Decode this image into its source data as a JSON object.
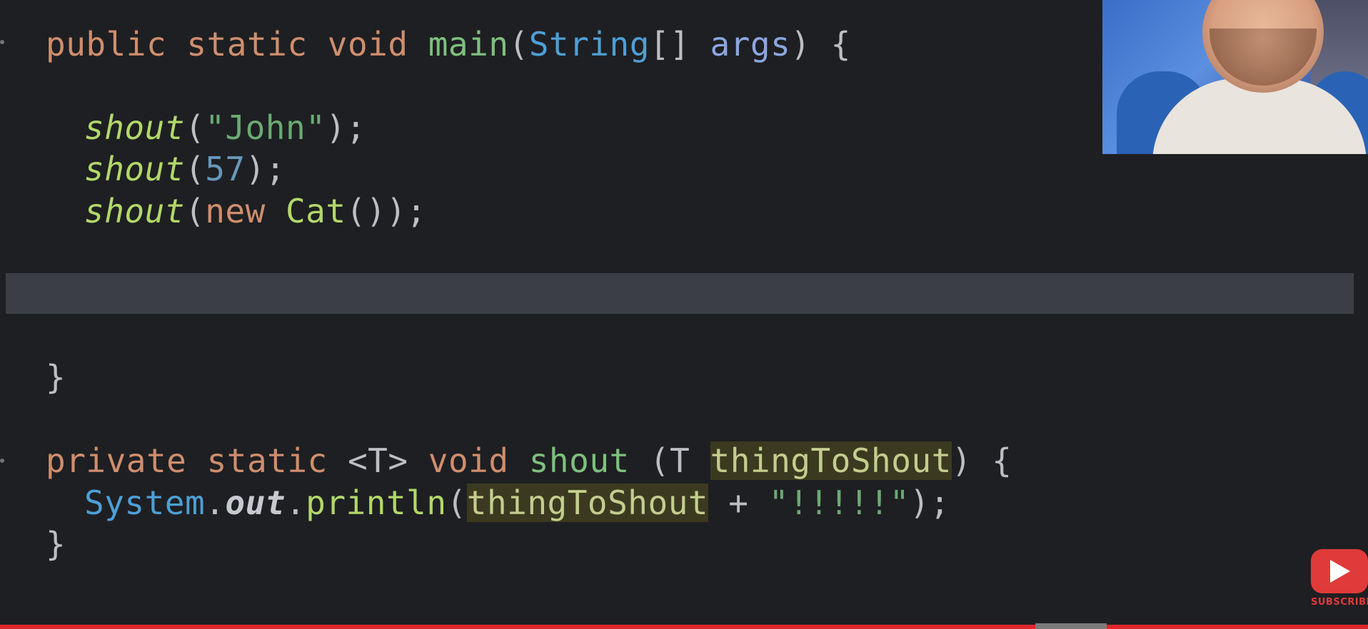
{
  "editor": {
    "lines": {
      "l1": {
        "kw1": "public",
        "kw2": "static",
        "kw3": "void",
        "fn": "main",
        "open": "(",
        "type": "String",
        "brackets": "[] ",
        "param": "args",
        "close": ") {"
      },
      "l2": {
        "call": "shout",
        "open": "(",
        "str": "\"John\"",
        "close": ");"
      },
      "l3": {
        "call": "shout",
        "open": "(",
        "num": "57",
        "close": ");"
      },
      "l4": {
        "call": "shout",
        "open": "(",
        "kw": "new",
        "cls": "Cat",
        "close": "());"
      },
      "l5": {
        "brace": "}"
      },
      "l6": {
        "kw1": "private",
        "kw2": "static",
        "tparam": "<T>",
        "kw3": "void",
        "fn": "shout",
        "open": " (T ",
        "param": "thingToShout",
        "close": ") {"
      },
      "l7": {
        "cls": "System",
        "dot1": ".",
        "field": "out",
        "dot2": ".",
        "method": "println",
        "open": "(",
        "param": "thingToShout",
        "plus": " + ",
        "str": "\"!!!!!\"",
        "close": ");"
      },
      "l8": {
        "brace": "}"
      }
    }
  },
  "overlay": {
    "subscribe_label": "SUBSCRIBE",
    "progress_fraction": 1.0
  },
  "colors": {
    "background": "#1e1f22",
    "keyword": "#cf8e6d",
    "string": "#6aab73",
    "number": "#6897bb",
    "call": "#b2d86a",
    "current_line": "#3b3e45",
    "youtube_red": "#e03a3a"
  }
}
